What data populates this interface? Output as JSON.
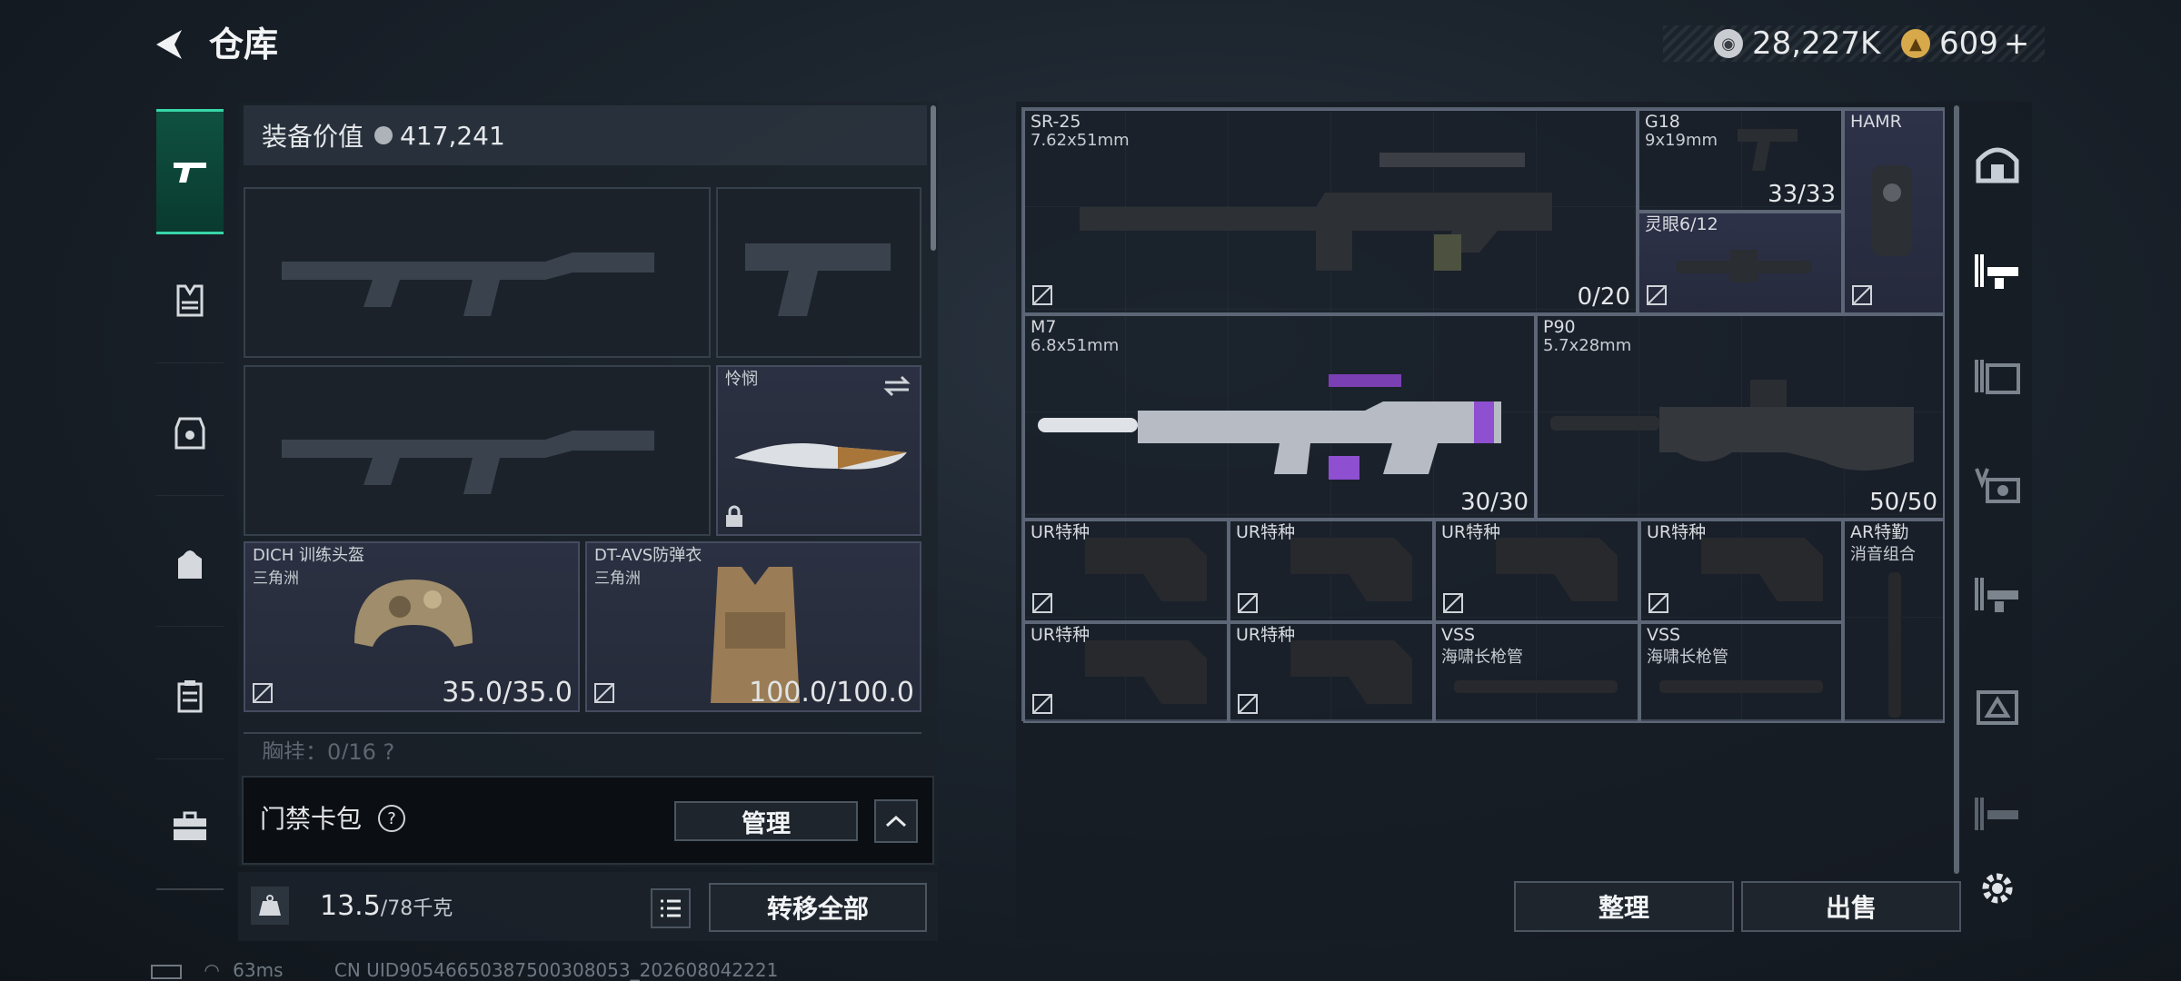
{
  "header": {
    "title": "仓库"
  },
  "currency": {
    "silver": "28,227K",
    "gold": "609",
    "gold_add": "+"
  },
  "loadout": {
    "value_label": "装备价值",
    "value": "417,241",
    "knife": {
      "name": "怜悯"
    },
    "helmet": {
      "name": "DICH 训练头盔",
      "sub": "三角洲",
      "durability": "35.0/35.0"
    },
    "armor": {
      "name": "DT-AVS防弹衣",
      "sub": "三角洲",
      "durability": "100.0/100.0"
    },
    "chest_row": "胸挂：0/16  ?",
    "keycard_label": "门禁卡包",
    "manage_label": "管理",
    "weight": "13.5",
    "weight_max": "/78千克",
    "transfer_all": "转移全部"
  },
  "stash": {
    "items": [
      {
        "name": "SR-25",
        "cal": "7.62x51mm",
        "ammo": "0/20"
      },
      {
        "name": "G18",
        "cal": "9x19mm",
        "ammo": "33/33"
      },
      {
        "name": "HAMR",
        "cal": "",
        "ammo": ""
      },
      {
        "name": "灵眼6/12",
        "cal": "",
        "ammo": ""
      },
      {
        "name": "M7",
        "cal": "6.8x51mm",
        "ammo": "30/30"
      },
      {
        "name": "P90",
        "cal": "5.7x28mm",
        "ammo": "50/50"
      },
      {
        "name": "UR特种",
        "cal": ""
      },
      {
        "name": "UR特种",
        "cal": ""
      },
      {
        "name": "UR特种",
        "cal": ""
      },
      {
        "name": "UR特种",
        "cal": ""
      },
      {
        "name": "AR特勤",
        "cal": "消音组合"
      },
      {
        "name": "UR特种",
        "cal": ""
      },
      {
        "name": "UR特种",
        "cal": ""
      },
      {
        "name": "VSS",
        "cal": "海啸长枪管"
      },
      {
        "name": "VSS",
        "cal": "海啸长枪管"
      }
    ],
    "sort_label": "整理",
    "sell_label": "出售"
  },
  "status": {
    "ping": "63ms",
    "uid": "CN UID9054665038750030805​3_202608042221"
  },
  "colors": {
    "accent": "#38d6a8",
    "panel": "#1b222a",
    "purple_item": "#2e3249"
  }
}
